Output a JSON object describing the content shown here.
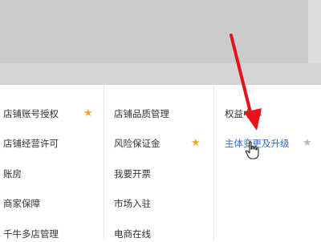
{
  "menu": {
    "col1": [
      {
        "label": "店铺账号授权",
        "starred": true,
        "star_color": "#f5a623"
      },
      {
        "label": "店铺经营许可"
      },
      {
        "label": "账房"
      },
      {
        "label": "商家保障"
      },
      {
        "label": "千牛多店管理"
      }
    ],
    "col2": [
      {
        "label": "店铺品质管理"
      },
      {
        "label": "风险保证金",
        "starred": true,
        "star_color": "#f5a623"
      },
      {
        "label": "我要开票"
      },
      {
        "label": "市场入驻"
      },
      {
        "label": "电商在线"
      }
    ],
    "col3": [
      {
        "label": "权益中心"
      },
      {
        "label": "主体变更及升级",
        "starred": true,
        "star_color": "#b8b8b8",
        "highlighted": true
      }
    ]
  },
  "icons": {
    "star": "★",
    "arrow": "red-annotation-arrow",
    "cursor": "hand-pointer"
  },
  "colors": {
    "annotation_arrow": "#e8121a",
    "link": "#2f6fd6",
    "star_active": "#f5a623",
    "star_inactive": "#b8b8b8"
  }
}
